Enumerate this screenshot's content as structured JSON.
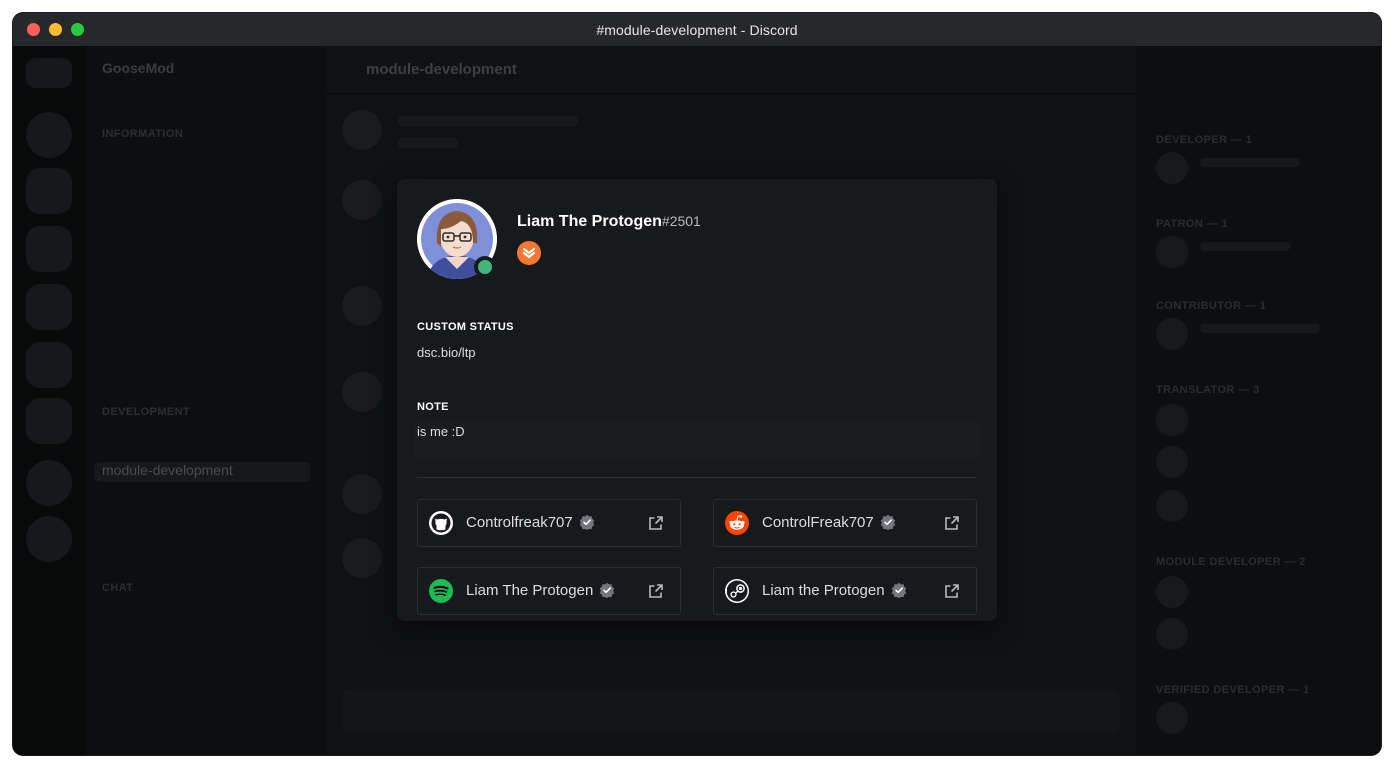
{
  "window": {
    "title": "#module-development - Discord"
  },
  "background": {
    "server_name": "GooseMod",
    "channel_header": "module-development",
    "categories": [
      "INFORMATION",
      "DEVELOPMENT",
      "CHAT"
    ],
    "active_channel": "module-development",
    "member_groups": [
      "DEVELOPER — 1",
      "PATRON — 1",
      "CONTRIBUTOR — 1",
      "TRANSLATOR — 3",
      "MODULE DEVELOPER — 2",
      "VERIFIED DEVELOPER — 1"
    ]
  },
  "profile": {
    "username": "Liam The Protogen",
    "discriminator": "#2501",
    "status": "online",
    "badge_icon": "hypesquad-bravery-icon",
    "custom_status_heading": "CUSTOM STATUS",
    "custom_status": "dsc.bio/ltp",
    "note_heading": "NOTE",
    "note": "is me :D",
    "connected_accounts": [
      {
        "service": "github",
        "name": "Controlfreak707",
        "verified": true
      },
      {
        "service": "reddit",
        "name": "ControlFreak707",
        "verified": true
      },
      {
        "service": "spotify",
        "name": "Liam The Protogen",
        "verified": true
      },
      {
        "service": "steam",
        "name": "Liam the Protogen",
        "verified": true
      }
    ]
  },
  "colors": {
    "online": "#43b581",
    "popout_bg": "#18191c",
    "reddit": "#ff4500",
    "spotify": "#1db954",
    "hypesquad": "#f57731"
  }
}
